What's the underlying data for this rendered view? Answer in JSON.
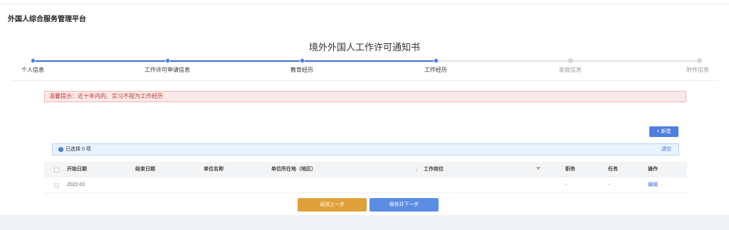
{
  "app": {
    "title": "外国人综合服务管理平台"
  },
  "form": {
    "title": "境外外国人工作许可通知书"
  },
  "steps": [
    {
      "label": "个人信息",
      "done": true
    },
    {
      "label": "工作许可申请信息",
      "done": true
    },
    {
      "label": "教育经历",
      "done": true
    },
    {
      "label": "工作经历",
      "done": true
    },
    {
      "label": "家庭信息",
      "done": false
    },
    {
      "label": "附件信息",
      "done": false
    }
  ],
  "tip": {
    "text": "温馨提示：近十年内的、实习不视为工作经历"
  },
  "toolbar": {
    "new_label": "+ 新建"
  },
  "selection": {
    "text": "已选择 0 项",
    "icon": "info-icon",
    "clear_label": "清空"
  },
  "table": {
    "headers": {
      "start_date": "开始日期",
      "end_date": "结束日期",
      "company": "单位名称",
      "location": "单位所在地（地区）",
      "position": "工作岗位",
      "duty": "职务",
      "task": "任务",
      "action": "操作"
    },
    "rows": [
      {
        "start_date": "2022-01",
        "end_date": "",
        "company": "",
        "location": "",
        "position": "",
        "duty": "-",
        "task": "-",
        "action": "编辑"
      }
    ]
  },
  "footer": {
    "prev_label": "返回上一步",
    "next_label": "保存并下一步"
  },
  "colors": {
    "primary": "#4f7fe0",
    "warning": "#e0a13a",
    "danger_text": "#c0392b"
  }
}
